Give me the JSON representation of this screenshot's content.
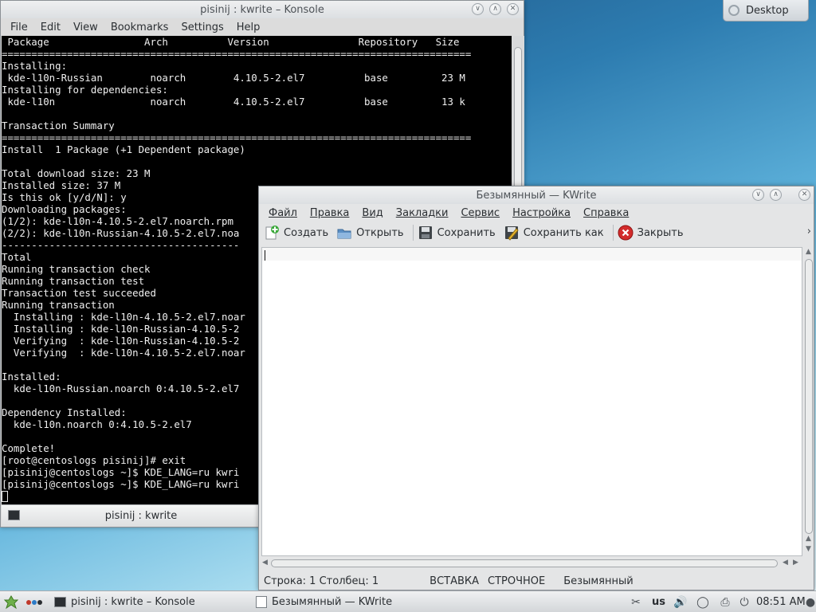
{
  "desktop_widget": {
    "label": "Desktop"
  },
  "konsole": {
    "title": "pisinij : kwrite – Konsole",
    "menu": [
      "File",
      "Edit",
      "View",
      "Bookmarks",
      "Settings",
      "Help"
    ],
    "terminal_lines": [
      " Package                Arch          Version               Repository   Size",
      "===============================================================================",
      "Installing:",
      " kde-l10n-Russian        noarch        4.10.5-2.el7          base         23 M",
      "Installing for dependencies:",
      " kde-l10n                noarch        4.10.5-2.el7          base         13 k",
      "",
      "Transaction Summary",
      "===============================================================================",
      "Install  1 Package (+1 Dependent package)",
      "",
      "Total download size: 23 M",
      "Installed size: 37 M",
      "Is this ok [y/d/N]: y",
      "Downloading packages:",
      "(1/2): kde-l10n-4.10.5-2.el7.noarch.rpm",
      "(2/2): kde-l10n-Russian-4.10.5-2.el7.noa",
      "----------------------------------------",
      "Total",
      "Running transaction check",
      "Running transaction test",
      "Transaction test succeeded",
      "Running transaction",
      "  Installing : kde-l10n-4.10.5-2.el7.noar",
      "  Installing : kde-l10n-Russian-4.10.5-2",
      "  Verifying  : kde-l10n-Russian-4.10.5-2",
      "  Verifying  : kde-l10n-4.10.5-2.el7.noar",
      "",
      "Installed:",
      "  kde-l10n-Russian.noarch 0:4.10.5-2.el7",
      "",
      "Dependency Installed:",
      "  kde-l10n.noarch 0:4.10.5-2.el7",
      "",
      "Complete!",
      "[root@centoslogs pisinij]# exit",
      "[pisinij@centoslogs ~]$ KDE_LANG=ru kwri",
      "[pisinij@centoslogs ~]$ KDE_LANG=ru kwri"
    ],
    "tab_label": "pisinij : kwrite"
  },
  "kwrite": {
    "title": "Безымянный — KWrite",
    "menu": [
      "Файл",
      "Правка",
      "Вид",
      "Закладки",
      "Сервис",
      "Настройка",
      "Справка"
    ],
    "toolbar": {
      "new": "Создать",
      "open": "Открыть",
      "save": "Сохранить",
      "save_as": "Сохранить как",
      "close": "Закрыть"
    },
    "status": {
      "position": "Строка: 1 Столбец: 1",
      "mode": "ВСТАВКА",
      "selection": "СТРОЧНОЕ",
      "document": "Безымянный"
    }
  },
  "taskbar": {
    "task_konsole": "pisinij : kwrite – Konsole",
    "task_kwrite": "Безымянный — KWrite",
    "keyboard_layout": "us",
    "clock": "08:51 AM"
  },
  "icons": {
    "minimize": "∨",
    "maximize": "∧",
    "close": "✕",
    "toolbar_more": "›"
  }
}
